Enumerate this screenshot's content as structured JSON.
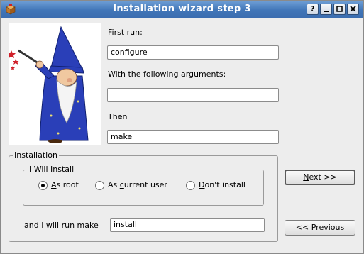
{
  "window": {
    "title": "Installation wizard step 3",
    "controls": {
      "help": "?",
      "minimize": "_",
      "maximize": "□",
      "close": "×"
    }
  },
  "form": {
    "first_run_label": "First run:",
    "first_run_value": "configure",
    "args_label": "With the following arguments:",
    "args_value": "",
    "then_label": "Then",
    "then_value": "make"
  },
  "installation": {
    "title": "Installation",
    "install_group": {
      "title": "I Will Install",
      "options": [
        {
          "label": "As root",
          "mnemonic": "A",
          "rest": "s root",
          "selected": true
        },
        {
          "label": "As current user",
          "prefix": "As ",
          "mnemonic": "c",
          "rest": "urrent user",
          "selected": false
        },
        {
          "label": "Don't install",
          "mnemonic": "D",
          "rest": "on't install",
          "selected": false
        }
      ]
    },
    "run_make_label": "and I will run make",
    "run_make_value": "install"
  },
  "buttons": {
    "next": {
      "label": "Next >>",
      "mnemonic": "N",
      "rest": "ext >>"
    },
    "previous": {
      "label": "<< Previous",
      "prefix": "<< ",
      "mnemonic": "P",
      "rest": "revious"
    }
  },
  "icons": {
    "app": "package-icon",
    "wizard": "wizard-illustration"
  },
  "colors": {
    "titlebar": "#4176b8",
    "wizard_robe": "#2a3fb8",
    "stars": "#d0202a"
  }
}
